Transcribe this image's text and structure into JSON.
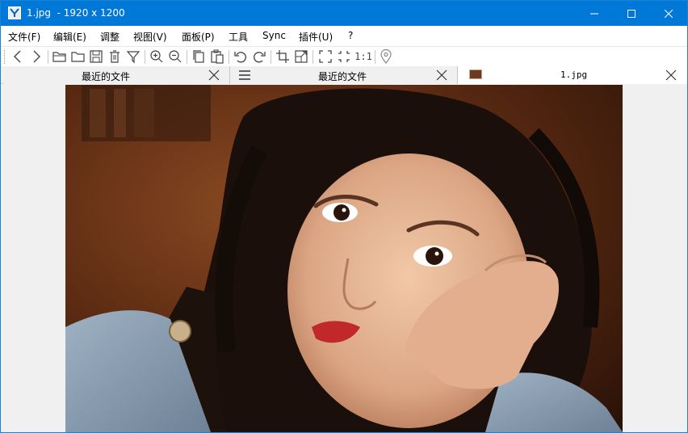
{
  "window": {
    "title": "1.jpg  - 1920 x 1200"
  },
  "menu": {
    "items": [
      {
        "label": "文件(F)"
      },
      {
        "label": "编辑(E)"
      },
      {
        "label": "调整"
      },
      {
        "label": "视图(V)"
      },
      {
        "label": "面板(P)"
      },
      {
        "label": "工具"
      },
      {
        "label": "Sync"
      },
      {
        "label": "插件(U)"
      },
      {
        "label": "?"
      }
    ]
  },
  "toolbar": {
    "icons": [
      "back-icon",
      "forward-icon",
      "open-folder-icon",
      "folder-icon",
      "save-icon",
      "delete-icon",
      "filter-icon",
      "zoom-in-icon",
      "zoom-out-icon",
      "copy-icon",
      "paste-icon",
      "rotate-left-icon",
      "rotate-right-icon",
      "crop-icon",
      "resize-icon",
      "fullscreen-icon",
      "fit-icon",
      "actual-size-icon",
      "location-icon"
    ],
    "actual_size_label": "1:1"
  },
  "tabs": [
    {
      "label": "最近的文件",
      "active": false
    },
    {
      "label": "最近的文件",
      "active": false
    },
    {
      "label": "1.jpg",
      "active": true
    }
  ],
  "colors": {
    "titlebar": "#0078d7",
    "accent": "#1883d7"
  }
}
